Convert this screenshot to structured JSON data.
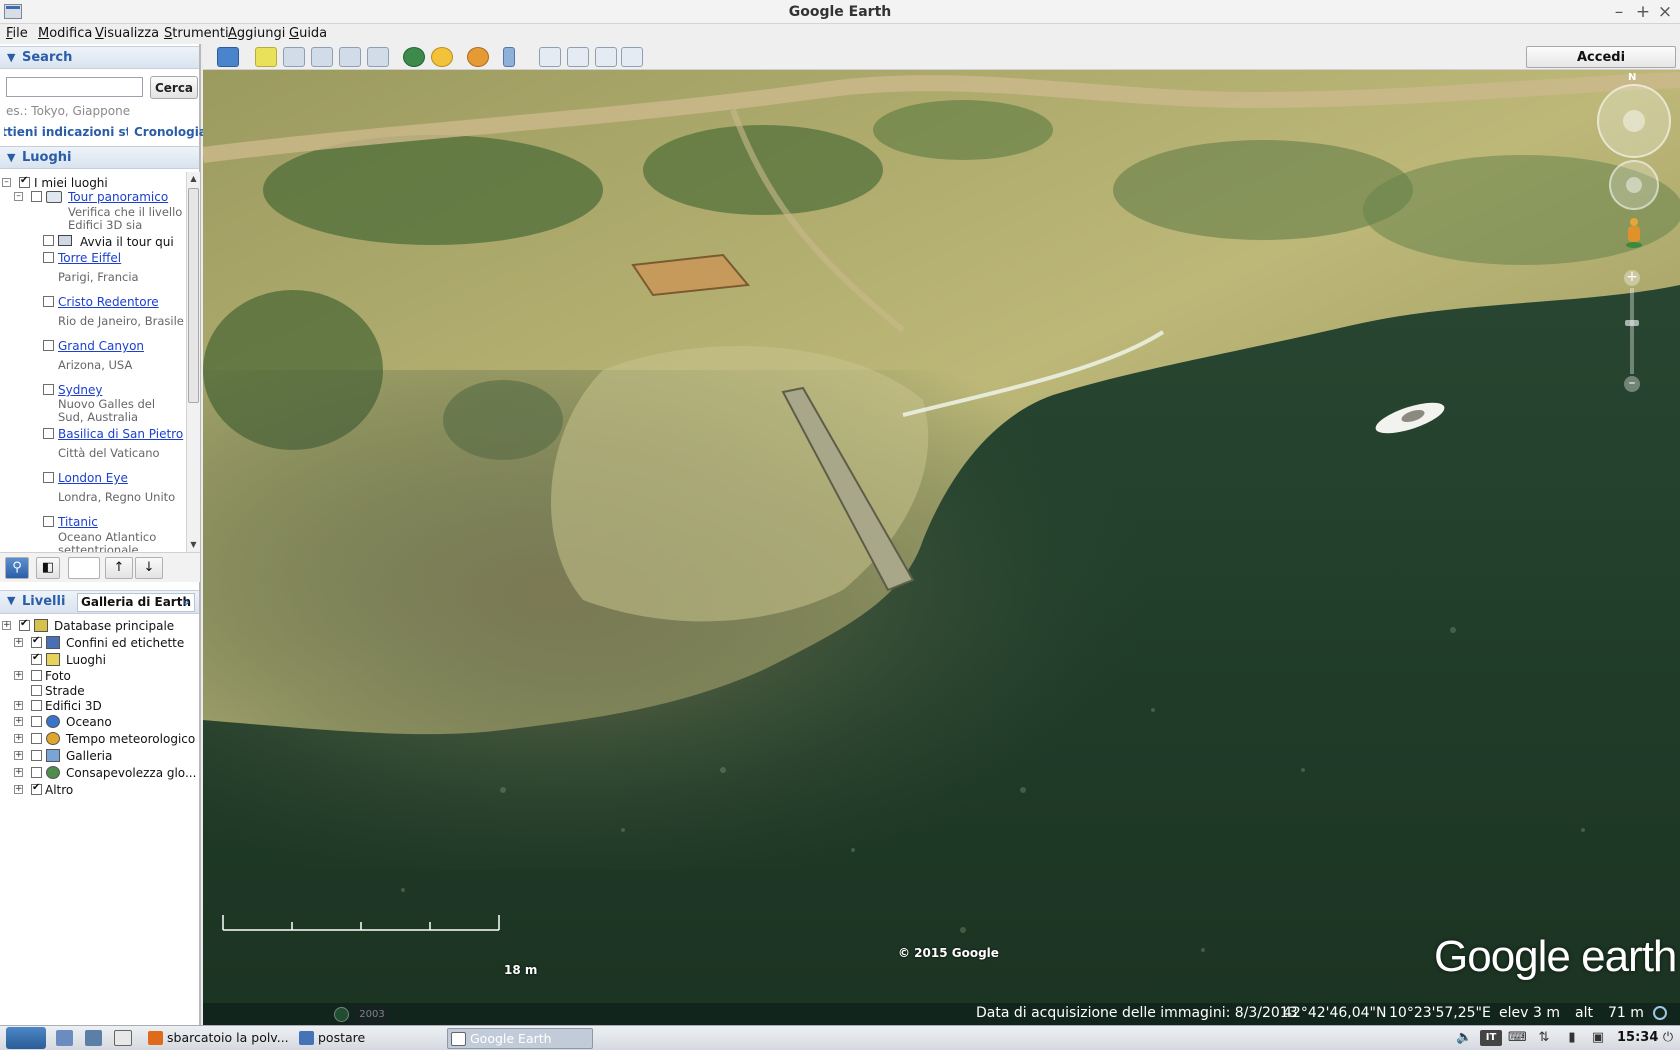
{
  "window": {
    "title": "Google Earth",
    "minimize": "–",
    "maximize": "+",
    "close": "×"
  },
  "menu": [
    "File",
    "Modifica",
    "Visualizza",
    "Strumenti",
    "Aggiungi",
    "Guida"
  ],
  "search": {
    "header": "Search",
    "input_value": "",
    "button": "Cerca",
    "hint": "es.: Tokyo, Giappone",
    "directions_link": "Ottieni indicazioni stradali",
    "history_link": "Cronologia"
  },
  "places": {
    "header": "Luoghi",
    "root": "I miei luoghi",
    "tour_folder": {
      "label": "Tour panoramico",
      "desc1": "Verifica che il livello",
      "desc2": "Edifici 3D sia"
    },
    "start_tour": "Avvia il tour qui",
    "items": [
      {
        "name": "Torre Eiffel",
        "desc": "Parigi, Francia"
      },
      {
        "name": "Cristo Redentore",
        "desc": "Rio de Janeiro, Brasile"
      },
      {
        "name": "Grand Canyon",
        "desc": "Arizona, USA"
      },
      {
        "name": "Sydney",
        "desc": "Nuovo Galles del Sud, Australia"
      },
      {
        "name": "Basilica di San Pietro",
        "desc": "Città del Vaticano"
      },
      {
        "name": "London Eye",
        "desc": "Londra, Regno Unito"
      },
      {
        "name": "Titanic",
        "desc": "Oceano Atlantico settentrionale"
      }
    ]
  },
  "layers": {
    "tab_layers": "Livelli",
    "tab_gallery": "Galleria di Earth",
    "gallery_chevron": "»",
    "items": [
      {
        "label": "Database principale",
        "checked": true
      },
      {
        "label": "Confini ed etichette",
        "checked": true
      },
      {
        "label": "Luoghi",
        "checked": true
      },
      {
        "label": "Foto",
        "checked": false
      },
      {
        "label": "Strade",
        "checked": false
      },
      {
        "label": "Edifici 3D",
        "checked": false
      },
      {
        "label": "Oceano",
        "checked": false
      },
      {
        "label": "Tempo meteorologico",
        "checked": false
      },
      {
        "label": "Galleria",
        "checked": false
      },
      {
        "label": "Consapevolezza glo...",
        "checked": false
      },
      {
        "label": "Altro",
        "checked": true
      }
    ]
  },
  "toolbar": {
    "signin": "Accedi"
  },
  "map": {
    "copyright": "© 2015 Google",
    "logo": "Google earth",
    "scale": "18 m",
    "year": "2003",
    "compass_n": "N"
  },
  "status": {
    "imagery_date": "Data di acquisizione delle immagini: 8/3/2013",
    "lat": "42°42'46,04\"N",
    "lon": "10°23'57,25\"E",
    "elev_label": "elev",
    "elev": "3 m",
    "alt_label": "alt",
    "alt": "71 m"
  },
  "taskbar": {
    "tasks": [
      "sbarcatoio la polv...",
      "postare",
      "Google Earth"
    ],
    "lang": "IT",
    "clock": "15:34"
  },
  "colors": {
    "accent": "#2a5da8",
    "link": "#1b3fd1",
    "sea": "#1f3a2a",
    "land": "#b9b271"
  }
}
